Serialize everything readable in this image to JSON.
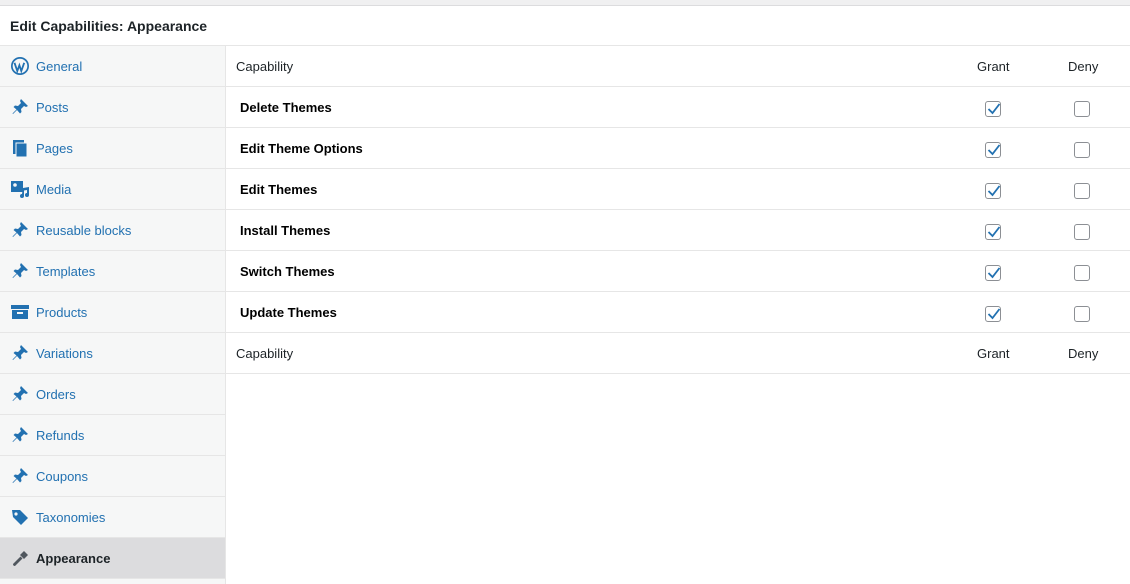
{
  "header": {
    "title": "Edit Capabilities: Appearance"
  },
  "sidebar": {
    "items": [
      {
        "label": "General",
        "icon": "wordpress-icon"
      },
      {
        "label": "Posts",
        "icon": "pin-icon"
      },
      {
        "label": "Pages",
        "icon": "pages-icon"
      },
      {
        "label": "Media",
        "icon": "media-icon"
      },
      {
        "label": "Reusable blocks",
        "icon": "pin-icon"
      },
      {
        "label": "Templates",
        "icon": "pin-icon"
      },
      {
        "label": "Products",
        "icon": "archive-icon"
      },
      {
        "label": "Variations",
        "icon": "pin-icon"
      },
      {
        "label": "Orders",
        "icon": "pin-icon"
      },
      {
        "label": "Refunds",
        "icon": "pin-icon"
      },
      {
        "label": "Coupons",
        "icon": "pin-icon"
      },
      {
        "label": "Taxonomies",
        "icon": "tag-icon"
      },
      {
        "label": "Appearance",
        "icon": "brush-icon",
        "active": true
      }
    ]
  },
  "table": {
    "header": {
      "capability": "Capability",
      "grant": "Grant",
      "deny": "Deny"
    },
    "footer": {
      "capability": "Capability",
      "grant": "Grant",
      "deny": "Deny"
    },
    "rows": [
      {
        "capability": "Delete Themes",
        "grant": true,
        "deny": false
      },
      {
        "capability": "Edit Theme Options",
        "grant": true,
        "deny": false
      },
      {
        "capability": "Edit Themes",
        "grant": true,
        "deny": false
      },
      {
        "capability": "Install Themes",
        "grant": true,
        "deny": false
      },
      {
        "capability": "Switch Themes",
        "grant": true,
        "deny": false
      },
      {
        "capability": "Update Themes",
        "grant": true,
        "deny": false
      }
    ]
  },
  "colors": {
    "link": "#2271b1",
    "active_bg": "#dcdcde",
    "sidebar_bg": "#f6f7f7",
    "check": "#2271b1"
  }
}
